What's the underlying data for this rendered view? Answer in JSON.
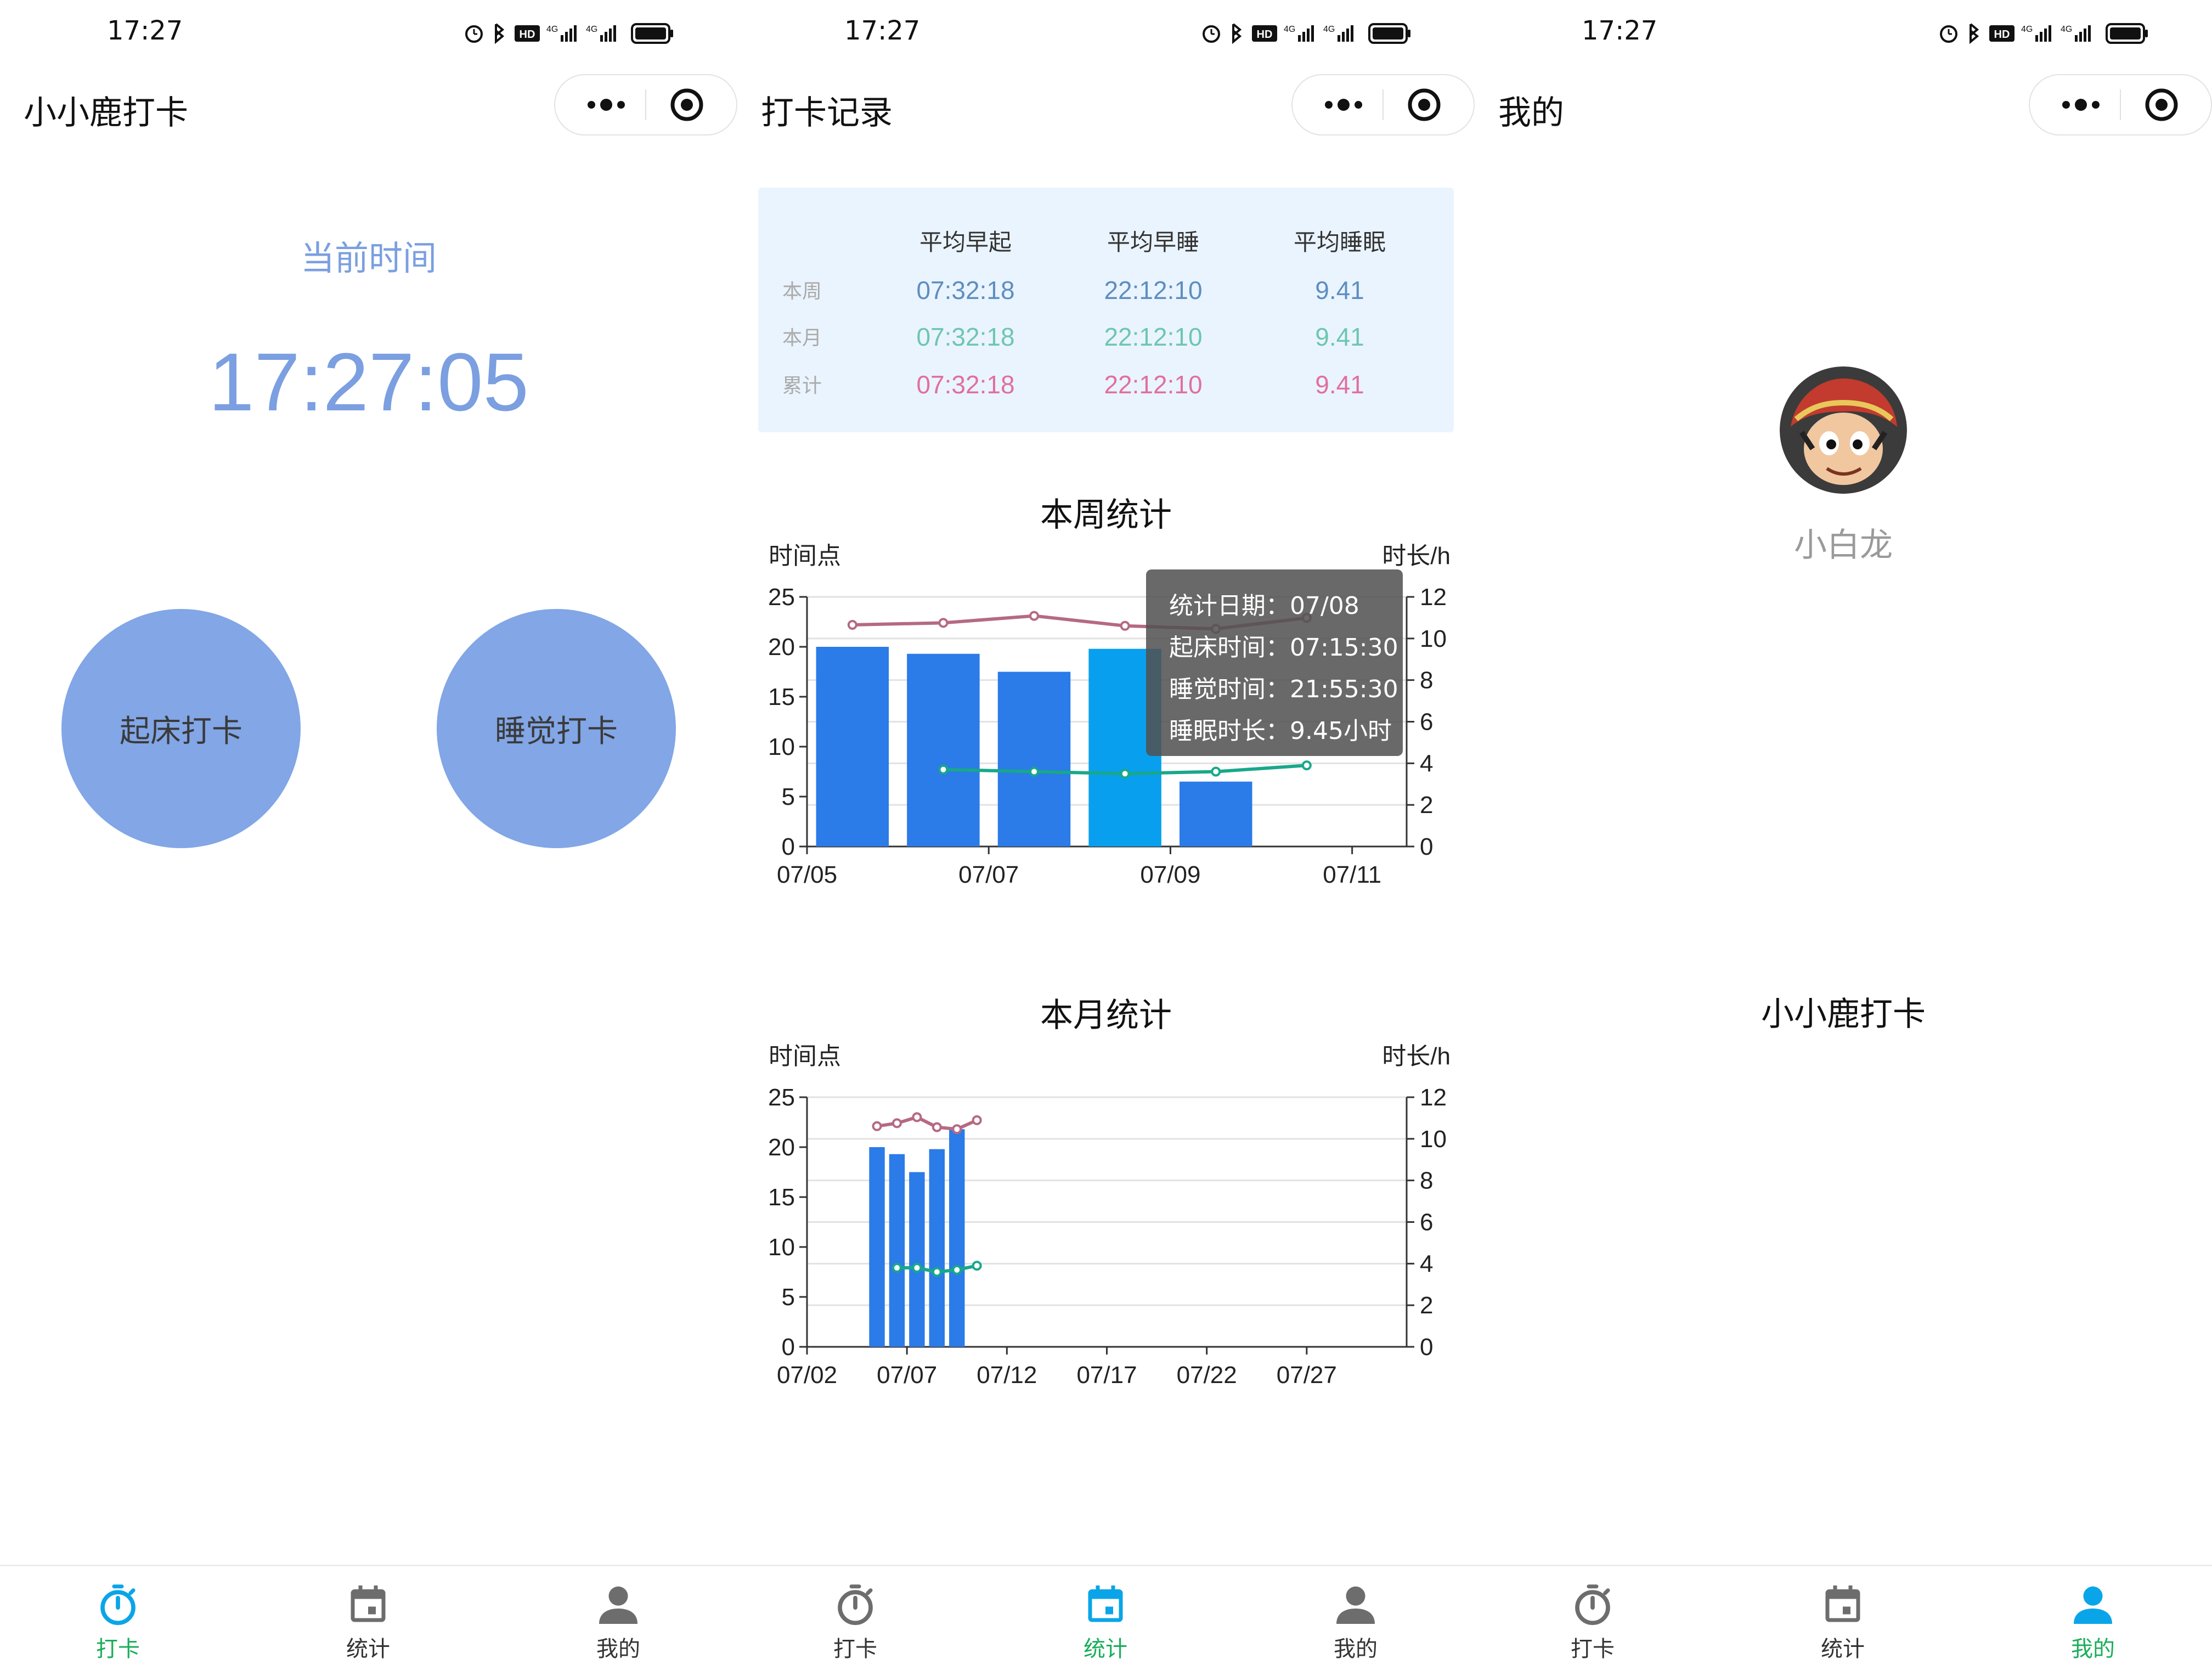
{
  "status": {
    "time": "17:27"
  },
  "colors": {
    "accent": "#82a6e6",
    "active_tab": "#1aad5a",
    "bar": "#2b7be8",
    "bar_highlight": "#08a0ee",
    "wake_line": "#b56a82",
    "sleep_line": "#18a88a"
  },
  "tabs": [
    {
      "label": "打卡",
      "icon": "stopwatch-icon"
    },
    {
      "label": "统计",
      "icon": "calendar-icon"
    },
    {
      "label": "我的",
      "icon": "person-icon"
    }
  ],
  "panel1": {
    "title": "小小鹿打卡",
    "current_time_label": "当前时间",
    "clock": "17:27:05",
    "wake_button": "起床打卡",
    "sleep_button": "睡觉打卡",
    "active_tab": 0
  },
  "panel2": {
    "title": "打卡记录",
    "active_tab": 1,
    "summary": {
      "headers": [
        "平均早起",
        "平均早睡",
        "平均睡眠"
      ],
      "rows": [
        {
          "label": "本周",
          "values": [
            "07:32:18",
            "22:12:10",
            "9.41"
          ],
          "color": "#5e8ec0"
        },
        {
          "label": "本月",
          "values": [
            "07:32:18",
            "22:12:10",
            "9.41"
          ],
          "color": "#6ec6b0"
        },
        {
          "label": "累计",
          "values": [
            "07:32:18",
            "22:12:10",
            "9.41"
          ],
          "color": "#e0709e"
        }
      ]
    },
    "tooltip": {
      "date": "统计日期：07/08",
      "wake": "起床时间：07:15:30",
      "sleep": "睡觉时间：21:55:30",
      "duration": "睡眠时长：9.45小时"
    }
  },
  "chart_data": [
    {
      "type": "bar",
      "title": "本周统计",
      "ylabel": "时间点",
      "y2label": "时长/h",
      "ylim": [
        0,
        25
      ],
      "y2lim": [
        0,
        12
      ],
      "yticks": [
        0,
        5,
        10,
        15,
        20,
        25
      ],
      "y2ticks": [
        0,
        2,
        4,
        6,
        8,
        10,
        12
      ],
      "xlim": [
        0,
        6.6
      ],
      "x": [
        0,
        1,
        2,
        3,
        4
      ],
      "xticks": [
        {
          "x": 0,
          "label": "07/05"
        },
        {
          "x": 2,
          "label": "07/07"
        },
        {
          "x": 4,
          "label": "07/09"
        },
        {
          "x": 6,
          "label": "07/11"
        }
      ],
      "bars": [
        {
          "x": 0,
          "value": 20
        },
        {
          "x": 1,
          "value": 19.3
        },
        {
          "x": 2,
          "value": 17.5
        },
        {
          "x": 3,
          "value": 19.8,
          "highlight": true
        },
        {
          "x": 4,
          "value": 6.5
        }
      ],
      "series": [
        {
          "axis": "y",
          "color": "#b56a82",
          "points": [
            [
              0,
              22.2
            ],
            [
              1,
              22.4
            ],
            [
              2,
              23.1
            ],
            [
              3,
              22.1
            ],
            [
              4,
              21.8
            ],
            [
              5,
              22.9
            ]
          ]
        },
        {
          "axis": "y2",
          "color": "#18a88a",
          "points": [
            [
              1,
              3.7
            ],
            [
              2,
              3.6
            ],
            [
              3,
              3.5
            ],
            [
              4,
              3.6
            ],
            [
              5,
              3.9
            ]
          ]
        }
      ]
    },
    {
      "type": "bar",
      "title": "本月统计",
      "ylabel": "时间点",
      "y2label": "时长/h",
      "ylim": [
        0,
        25
      ],
      "y2lim": [
        0,
        12
      ],
      "yticks": [
        0,
        5,
        10,
        15,
        20,
        25
      ],
      "y2ticks": [
        0,
        2,
        4,
        6,
        8,
        10,
        12
      ],
      "xlim": [
        0,
        30
      ],
      "xticks": [
        {
          "x": 0,
          "label": "07/02"
        },
        {
          "x": 5,
          "label": "07/07"
        },
        {
          "x": 10,
          "label": "07/12"
        },
        {
          "x": 15,
          "label": "07/17"
        },
        {
          "x": 20,
          "label": "07/22"
        },
        {
          "x": 25,
          "label": "07/27"
        }
      ],
      "bars": [
        {
          "x": 3,
          "value": 20
        },
        {
          "x": 4,
          "value": 19.3
        },
        {
          "x": 5,
          "value": 17.5
        },
        {
          "x": 6,
          "value": 19.8
        },
        {
          "x": 7,
          "value": 21.8
        }
      ],
      "series": [
        {
          "axis": "y",
          "color": "#b56a82",
          "points": [
            [
              3,
              22.1
            ],
            [
              4,
              22.4
            ],
            [
              5,
              23.0
            ],
            [
              6,
              22.0
            ],
            [
              7,
              21.8
            ],
            [
              8,
              22.7
            ]
          ]
        },
        {
          "axis": "y2",
          "color": "#18a88a",
          "points": [
            [
              4,
              3.8
            ],
            [
              5,
              3.8
            ],
            [
              6,
              3.6
            ],
            [
              7,
              3.7
            ],
            [
              8,
              3.9
            ]
          ]
        }
      ]
    }
  ],
  "panel3": {
    "title": "我的",
    "user_name": "小白龙",
    "app_name": "小小鹿打卡",
    "active_tab": 2
  }
}
